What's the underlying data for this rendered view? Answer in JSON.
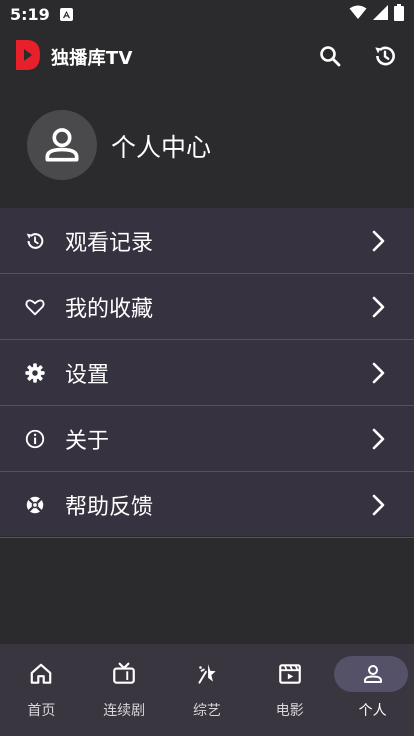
{
  "status_bar": {
    "time": "5:19",
    "notification_icon": "a-box-icon",
    "icons": [
      "wifi-icon",
      "signal-icon",
      "battery-icon"
    ]
  },
  "app_bar": {
    "title": "独播库TV",
    "logo_color": "#e8202a",
    "actions": [
      "search-icon",
      "history-icon"
    ]
  },
  "profile": {
    "name": "个人中心",
    "avatar_icon": "person-icon"
  },
  "menu": {
    "items": [
      {
        "label": "观看记录",
        "icon": "history-icon"
      },
      {
        "label": "我的收藏",
        "icon": "heart-icon"
      },
      {
        "label": "设置",
        "icon": "gear-icon"
      },
      {
        "label": "关于",
        "icon": "info-icon"
      },
      {
        "label": "帮助反馈",
        "icon": "lifebuoy-icon"
      }
    ]
  },
  "bottom_nav": {
    "items": [
      {
        "label": "首页",
        "icon": "home-icon"
      },
      {
        "label": "连续剧",
        "icon": "tv-icon"
      },
      {
        "label": "综艺",
        "icon": "sparkle-icon"
      },
      {
        "label": "电影",
        "icon": "film-icon"
      },
      {
        "label": "个人",
        "icon": "person-icon",
        "active": true
      }
    ]
  },
  "colors": {
    "background": "#2b2b2d",
    "menu_background": "#36323f",
    "nav_background": "#3a3640",
    "nav_active_pill": "#555168",
    "brand_red": "#e8202a"
  }
}
